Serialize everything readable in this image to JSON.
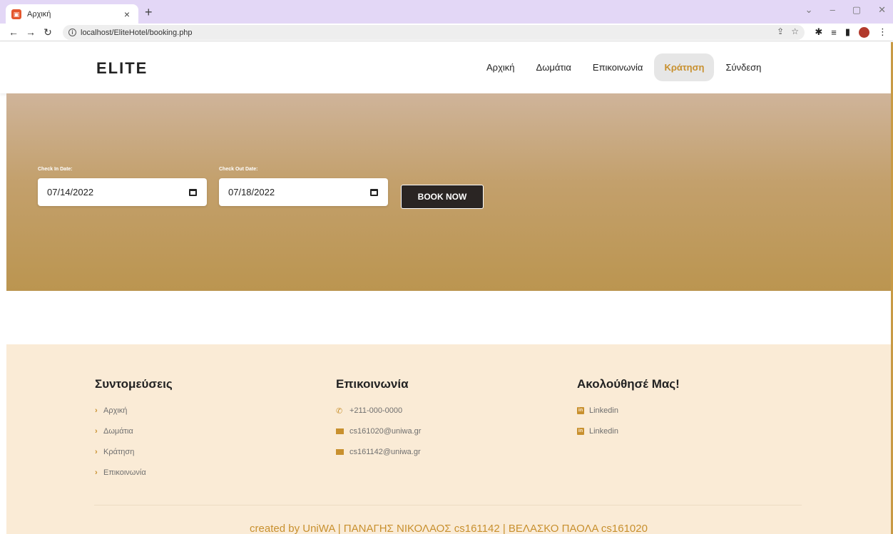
{
  "browser": {
    "tab_title": "Αρχική",
    "tab_close": "×",
    "new_tab": "+",
    "url": "localhost/EliteHotel/booking.php",
    "window_controls": [
      "⌄",
      "–",
      "▢",
      "✕"
    ]
  },
  "header": {
    "logo": "ELITE",
    "nav": [
      {
        "label": "Αρχική",
        "active": false
      },
      {
        "label": "Δωμάτια",
        "active": false
      },
      {
        "label": "Επικοινωνία",
        "active": false
      },
      {
        "label": "Κράτηση",
        "active": true
      },
      {
        "label": "Σύνδεση",
        "active": false
      }
    ]
  },
  "booking": {
    "check_in_label": "Check In Date:",
    "check_in_value": "07/14/2022",
    "check_out_label": "Check Out Date:",
    "check_out_value": "07/18/2022",
    "button_label": "BOOK NOW"
  },
  "footer": {
    "shortcuts": {
      "title": "Συντομεύσεις",
      "items": [
        "Αρχική",
        "Δωμάτια",
        "Κράτηση",
        "Επικοινωνία"
      ]
    },
    "contact": {
      "title": "Επικοινωνία",
      "phone": "+211-000-0000",
      "email1": "cs161020@uniwa.gr",
      "email2": "cs161142@uniwa.gr"
    },
    "follow": {
      "title": "Ακολούθησέ Μας!",
      "items": [
        "Linkedin",
        "Linkedin"
      ]
    },
    "credits": "created by UniWA | ΠΑΝΑΓΗΣ ΝΙΚΟΛΑΟΣ cs161142 | ΒΕΛΑΣΚΟ ΠΑΟΛΑ cs161020"
  },
  "colors": {
    "accent": "#c8902e",
    "hero_top": "#cfb49a",
    "hero_bottom": "#bb9550",
    "footer_bg": "#faebd6",
    "button_bg": "#2a2523"
  }
}
